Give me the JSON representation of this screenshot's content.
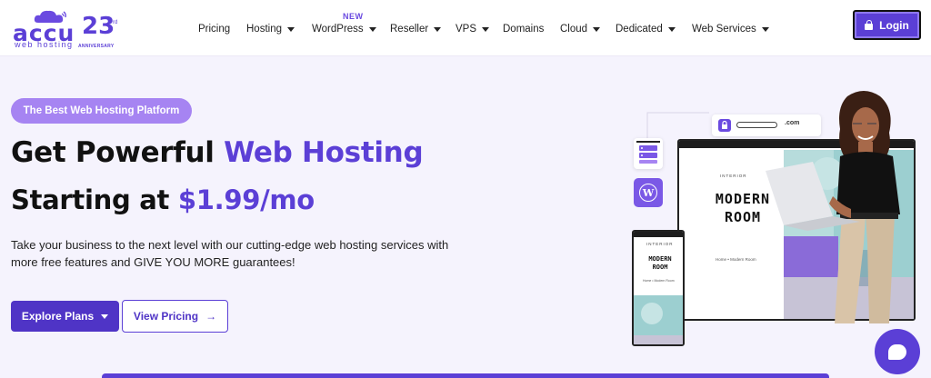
{
  "brand": {
    "logo_word": "accu",
    "logo_sub": "web hosting",
    "anniversary_number": "23",
    "anniversary_suffix": "rd",
    "anniversary_label": "ANNIVERSARY",
    "color": "#5b3fd6"
  },
  "nav": {
    "new_badge": "NEW",
    "items": [
      {
        "label": "Pricing",
        "dropdown": false
      },
      {
        "label": "Hosting",
        "dropdown": true
      },
      {
        "label": "WordPress",
        "dropdown": true
      },
      {
        "label": "Reseller",
        "dropdown": true
      },
      {
        "label": "VPS",
        "dropdown": true
      },
      {
        "label": "Domains",
        "dropdown": false
      },
      {
        "label": "Cloud",
        "dropdown": true
      },
      {
        "label": "Dedicated",
        "dropdown": true
      },
      {
        "label": "Web Services",
        "dropdown": true
      }
    ],
    "login_label": "Login"
  },
  "hero": {
    "badge": "The Best Web Hosting Platform",
    "headline_prefix": "Get Powerful ",
    "headline_accent": "Web Hosting",
    "subheadline_prefix": "Starting at ",
    "subheadline_price": "$1.99/mo",
    "description": "Take your business to the next level with our cutting-edge web hosting services with more free features and GIVE YOU MORE guarantees!",
    "primary_button": "Explore Plans",
    "secondary_button": "View Pricing",
    "secondary_button_arrow": "→"
  },
  "illustration": {
    "url_tld": ".com",
    "interior_label": "INTERIOR",
    "room_title_line1": "MODERN",
    "room_title_line2": "ROOM",
    "crumb": "Home  •  Modern Room",
    "wp_letter": "W"
  },
  "colors": {
    "accent": "#5b3fd6",
    "badge_bg": "#a684f2",
    "hero_bg": "#f5f3fd"
  }
}
